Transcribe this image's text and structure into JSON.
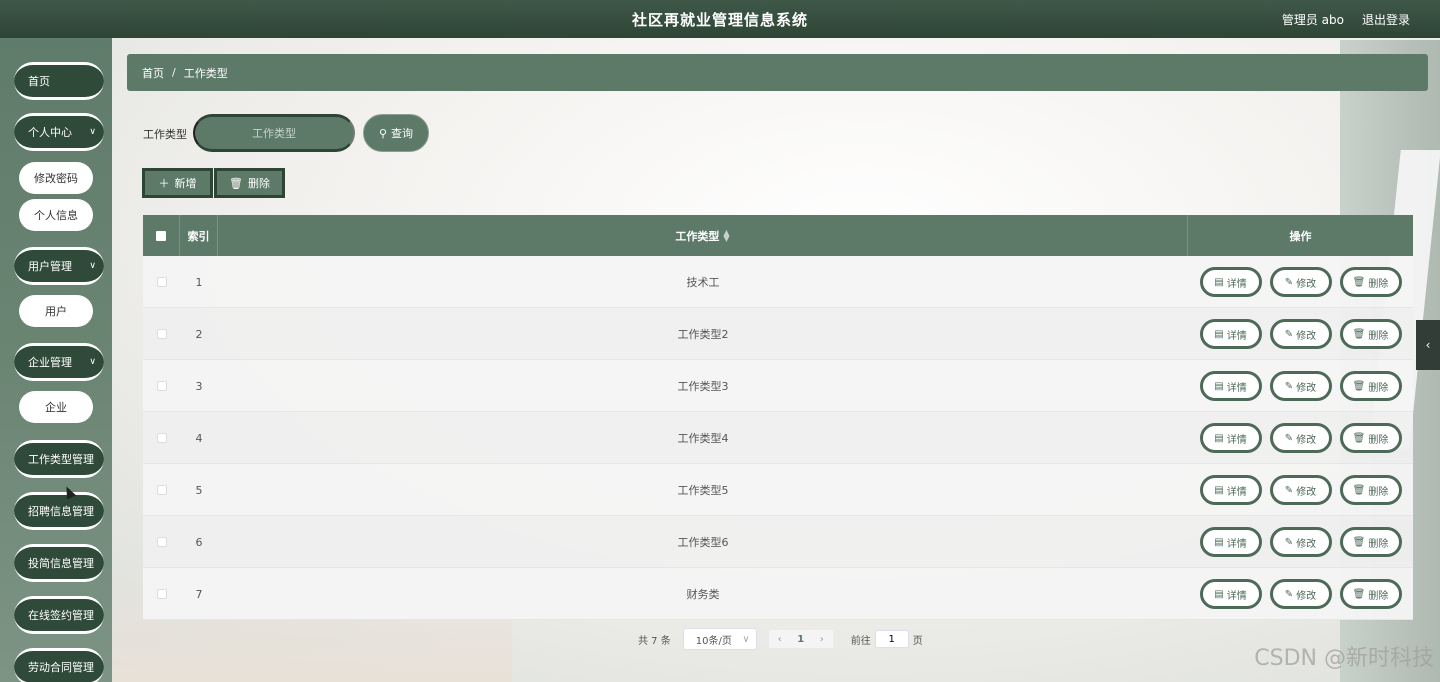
{
  "header": {
    "title": "社区再就业管理信息系统",
    "user": "管理员 abo",
    "logout": "退出登录"
  },
  "sidebar": {
    "home": "首页",
    "personal": "个人中心",
    "change_password": "修改密码",
    "personal_info": "个人信息",
    "user_mgmt": "用户管理",
    "user": "用户",
    "company_mgmt": "企业管理",
    "company": "企业",
    "jobtype_mgmt": "工作类型管理",
    "recruit_mgmt": "招聘信息管理",
    "resume_mgmt": "投简信息管理",
    "sign_mgmt": "在线签约管理",
    "contract_mgmt": "劳动合同管理"
  },
  "breadcrumb": {
    "home": "首页",
    "sep": "/",
    "current": "工作类型"
  },
  "filter": {
    "label": "工作类型",
    "placeholder": "工作类型",
    "query": "查询"
  },
  "actions": {
    "add": "新增",
    "delete": "删除"
  },
  "table": {
    "headers": {
      "index": "索引",
      "type": "工作类型",
      "ops": "操作"
    },
    "ops": {
      "detail": "详情",
      "edit": "修改",
      "delete": "删除"
    },
    "rows": [
      {
        "index": "1",
        "type": "技术工"
      },
      {
        "index": "2",
        "type": "工作类型2"
      },
      {
        "index": "3",
        "type": "工作类型3"
      },
      {
        "index": "4",
        "type": "工作类型4"
      },
      {
        "index": "5",
        "type": "工作类型5"
      },
      {
        "index": "6",
        "type": "工作类型6"
      },
      {
        "index": "7",
        "type": "财务类"
      }
    ]
  },
  "pagination": {
    "total": "共 7 条",
    "page_size": "10条/页",
    "current_page": "1",
    "goto": "前往",
    "goto_value": "1",
    "page_unit": "页"
  },
  "watermark": "CSDN @新时科技",
  "colors": {
    "primary": "#5d7a68",
    "dark": "#2e4536"
  }
}
